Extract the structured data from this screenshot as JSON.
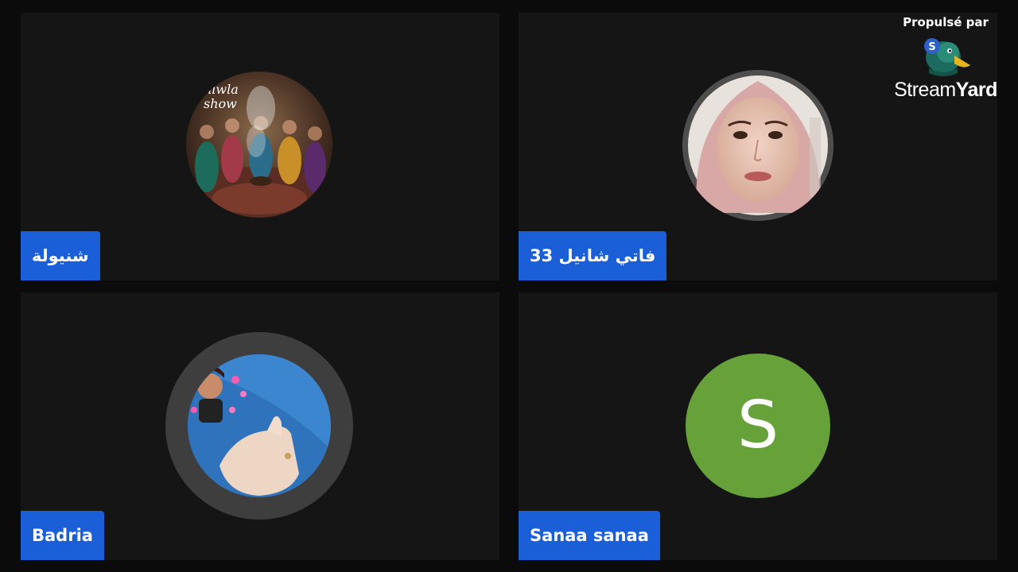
{
  "branding": {
    "powered_by": "Propulsé par",
    "brand_name_light": "Stream",
    "brand_name_bold": "Yard",
    "logo_icon": "streamyard-duck-logo-icon"
  },
  "participants": [
    {
      "name": "شنيولة",
      "avatar": "group-photo",
      "avatar_text": "niwla show"
    },
    {
      "name": "فاتي شانيل 33",
      "avatar": "portrait-photo"
    },
    {
      "name": "Badria",
      "avatar": "bitmoji-hand-photo"
    },
    {
      "name": "Sanaa sanaa",
      "avatar": "letter",
      "avatar_letter": "S",
      "avatar_color": "#67a13a"
    }
  ],
  "colors": {
    "name_tag": "#1a5fd8",
    "tile_bg": "#151515",
    "page_bg": "#0b0b0b"
  }
}
